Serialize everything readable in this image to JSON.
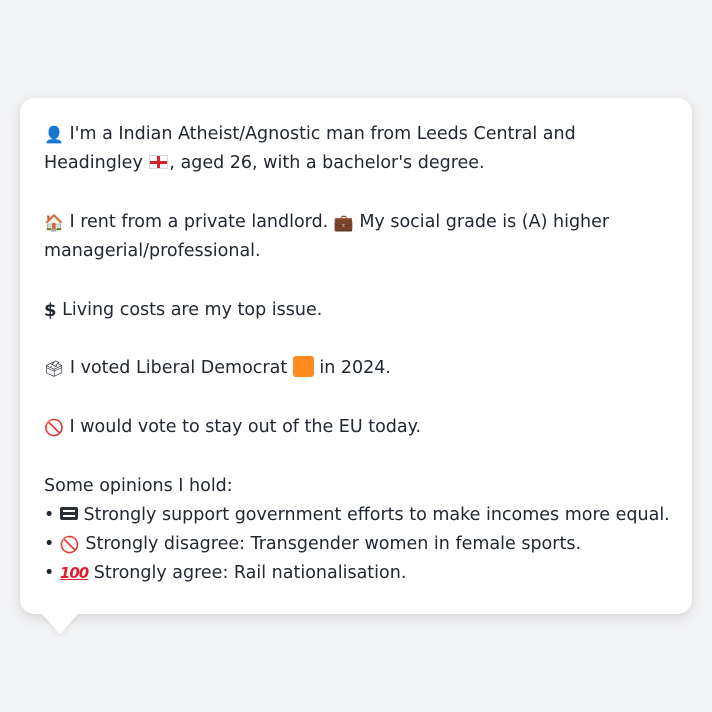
{
  "profile": {
    "intro": "I'm a Indian Atheist/Agnostic man from Leeds Central and Headingley",
    "intro_tail": ", aged 26, with a bachelor's degree.",
    "housing": "I rent from a private landlord.",
    "grade": "My social grade is (A) higher managerial/professional.",
    "top_issue": "Living costs are my top issue.",
    "vote_prefix": "I voted Liberal Democrat",
    "vote_suffix": "in 2024.",
    "eu": "I would vote to stay out of the EU today.",
    "opinions_header": "Some opinions I hold:",
    "opinions": [
      {
        "icon": "equals-icon",
        "text": "Strongly support government efforts to make incomes more equal."
      },
      {
        "icon": "prohibited-icon",
        "text": "Strongly disagree: Transgender women in female sports."
      },
      {
        "icon": "hundred-points-icon",
        "text": "Strongly agree: Rail nationalisation."
      }
    ]
  },
  "icons": {
    "person": "person-silhouette-icon",
    "flag": "england-flag-icon",
    "house": "house-icon",
    "briefcase": "briefcase-icon",
    "dollar": "dollar-sign-icon",
    "ballot": "ballot-box-icon",
    "party_color": "#ff8a1d",
    "no": "prohibited-icon"
  },
  "bullet": "•"
}
